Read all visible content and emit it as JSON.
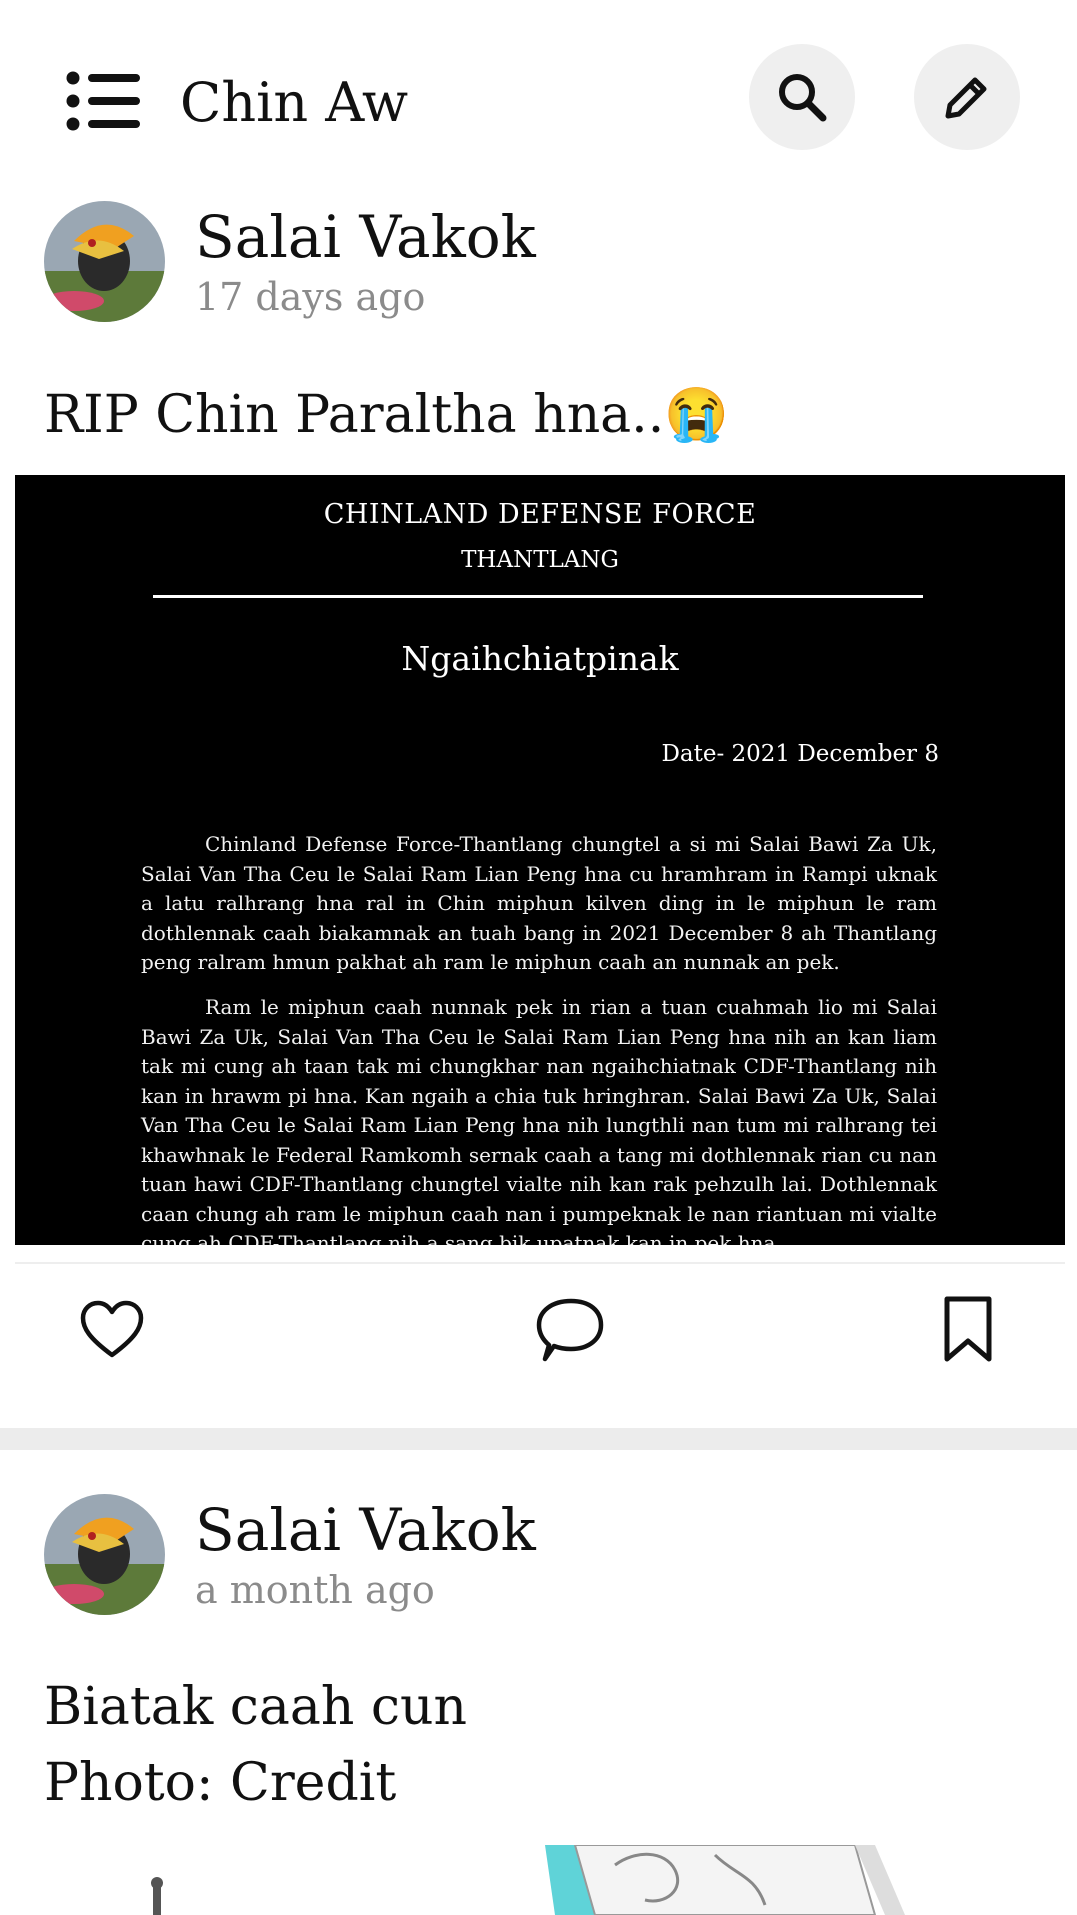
{
  "header": {
    "title": "Chin Aw",
    "menu_icon": "menu-list-icon",
    "search_icon": "search-icon",
    "edit_icon": "pencil-icon"
  },
  "posts": [
    {
      "author": "Salai Vakok",
      "time": "17 days ago",
      "text": "RIP Chin Paraltha hna..😭",
      "image": {
        "org": "CHINLAND DEFENSE FORCE",
        "unit": "THANTLANG",
        "title": "Ngaihchiatpinak",
        "date": "Date- 2021 December 8",
        "para1": "Chinland Defense Force-Thantlang chungtel a si mi Salai Bawi Za Uk, Salai Van Tha Ceu le Salai Ram Lian Peng hna cu hramhram in Rampi uknak a latu ralhrang hna ral in Chin miphun kilven ding in le miphun le ram dothlennak caah biakamnak an tuah bang in 2021 December 8 ah Thantlang peng ralram hmun pakhat ah ram le miphun caah an nunnak an pek.",
        "para2": "Ram le miphun caah nunnak pek in rian a tuan cuahmah lio mi Salai Bawi Za Uk, Salai Van Tha Ceu le Salai Ram Lian Peng hna nih an kan liam tak mi cung ah taan tak mi chungkhar nan ngaihchiatnak CDF-Thantlang nih kan in hrawm pi hna. Kan ngaih a chia tuk hringhran. Salai Bawi Za Uk, Salai Van Tha Ceu le Salai Ram Lian Peng hna nih lungthli nan tum mi ralhrang tei khawhnak le Federal Ramkomh sernak caah a tang mi dothlennak rian cu nan tuan hawi CDF-Thantlang chungtel vialte nih kan rak pehzulh lai. Dothlennak caan chung ah ram le miphun caah nan i pumpeknak le nan riantuan mi vialte cung ah CDF-Thantlang nih a sang bik upatnak kan in pek hna."
      }
    },
    {
      "author": "Salai Vakok",
      "time": "a month ago",
      "text_line1": "Biatak caah cun",
      "text_line2": "Photo: Credit"
    }
  ],
  "actions": {
    "like_icon": "heart-icon",
    "comment_icon": "comment-icon",
    "bookmark_icon": "bookmark-icon"
  },
  "colors": {
    "button_bg": "#efefef",
    "time_text": "#8b8b8b",
    "separator": "#ececec"
  }
}
